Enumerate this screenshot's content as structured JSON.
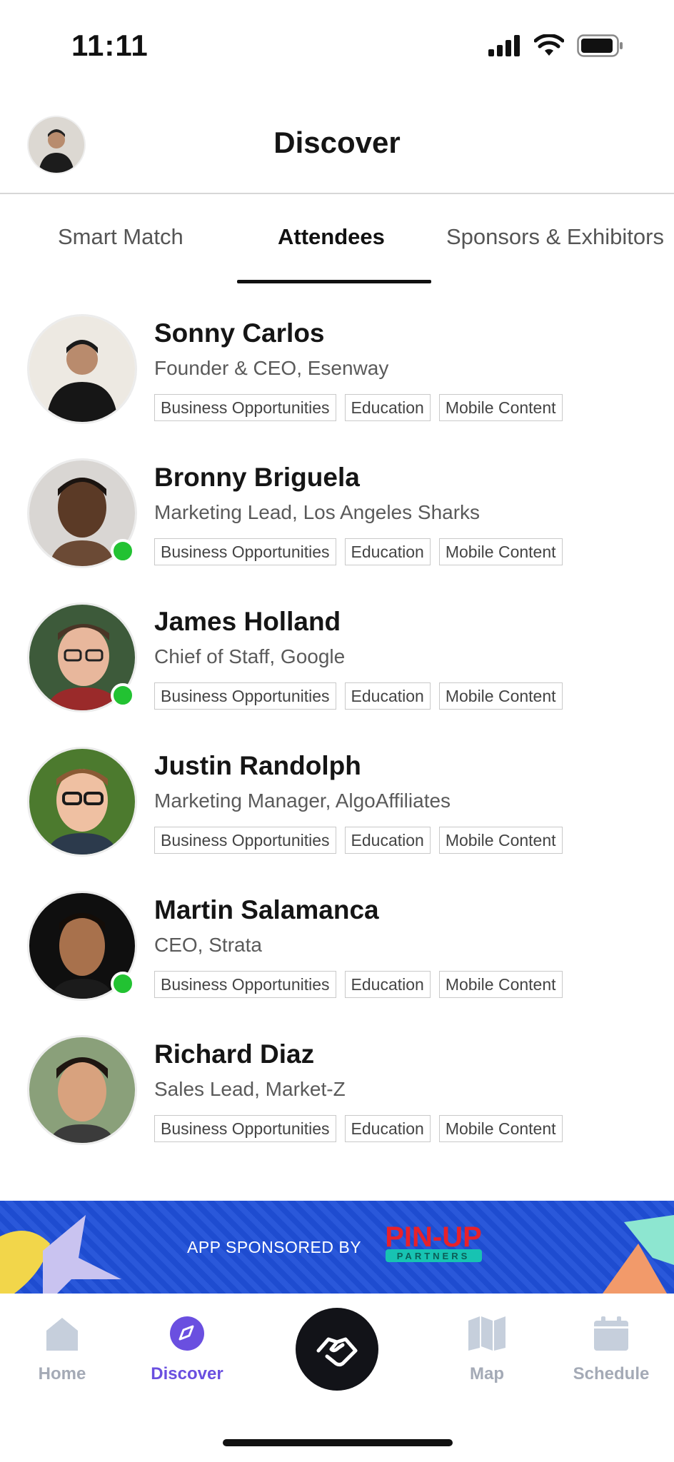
{
  "status_bar": {
    "time": "11:11"
  },
  "header": {
    "title": "Discover"
  },
  "tabs": [
    {
      "label": "Smart Match",
      "active": false
    },
    {
      "label": "Attendees",
      "active": true
    },
    {
      "label": "Sponsors & Exhibitors",
      "active": false
    }
  ],
  "attendees": [
    {
      "name": "Sonny Carlos",
      "role": "Founder & CEO, Esenway",
      "online": false,
      "tags": [
        "Business Opportunities",
        "Education",
        "Mobile Content"
      ]
    },
    {
      "name": "Bronny Briguela",
      "role": "Marketing Lead, Los Angeles Sharks",
      "online": true,
      "tags": [
        "Business Opportunities",
        "Education",
        "Mobile Content"
      ]
    },
    {
      "name": "James Holland",
      "role": "Chief of Staff, Google",
      "online": true,
      "tags": [
        "Business Opportunities",
        "Education",
        "Mobile Content"
      ]
    },
    {
      "name": "Justin  Randolph",
      "role": "Marketing Manager, AlgoAffiliates",
      "online": false,
      "tags": [
        "Business Opportunities",
        "Education",
        "Mobile Content"
      ]
    },
    {
      "name": "Martin Salamanca",
      "role": "CEO, Strata",
      "online": true,
      "tags": [
        "Business Opportunities",
        "Education",
        "Mobile Content"
      ]
    },
    {
      "name": "Richard Diaz",
      "role": "Sales Lead, Market-Z",
      "online": false,
      "tags": [
        "Business Opportunities",
        "Education",
        "Mobile Content"
      ]
    }
  ],
  "banner": {
    "text": "APP SPONSORED BY",
    "logo_text": "PIN-UP",
    "logo_subtext": "PARTNERS"
  },
  "nav": {
    "items": [
      {
        "label": "Home",
        "icon": "home-icon",
        "active": false
      },
      {
        "label": "Discover",
        "icon": "compass-icon",
        "active": true
      },
      {
        "label": "Map",
        "icon": "map-icon",
        "active": false
      },
      {
        "label": "Schedule",
        "icon": "calendar-icon",
        "active": false
      }
    ],
    "center_icon": "handshake-icon"
  },
  "colors": {
    "accent": "#6a4fe0",
    "online": "#22c232",
    "banner": "#1f4fd8",
    "logo_red": "#e8212a",
    "logo_teal": "#17c3b2"
  }
}
